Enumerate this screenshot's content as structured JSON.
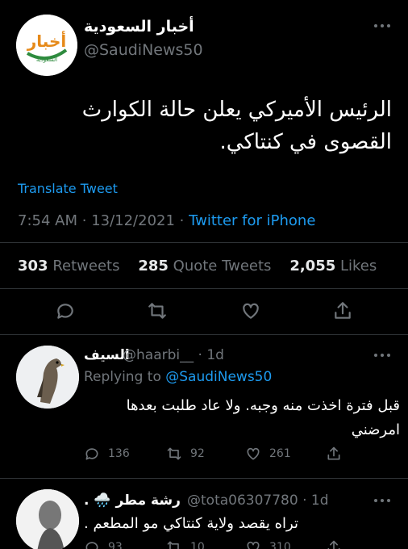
{
  "tweet": {
    "display_name": "أخبار السعودية",
    "handle": "@SaudiNews50",
    "logo_text": "أخبار",
    "logo_subtext": "السعودية",
    "text": "الرئيس الأميركي يعلن حالة الكوارث القصوى في كنتاكي.",
    "translate_label": "Translate Tweet",
    "time": "7:54 AM",
    "date": "13/12/2021",
    "source": "Twitter for iPhone",
    "retweets_count": "303",
    "retweets_label": "Retweets",
    "quotes_count": "285",
    "quotes_label": "Quote Tweets",
    "likes_count": "2,055",
    "likes_label": "Likes"
  },
  "replies": [
    {
      "name": "السيف",
      "handle": "@haarbi__",
      "age": "1d",
      "replying_label": "Replying to",
      "replying_to": "@SaudiNews50",
      "text": "قبل فترة اخذت منه وجبه. ولا عاد طلبت بعدها امرضني",
      "replies": "136",
      "retweets": "92",
      "likes": "261"
    },
    {
      "name": "رشة مطر 🌧️ .",
      "handle": "@tota06307780",
      "age": "1d",
      "text": "تراه يقصد ولاية كنتاكي مو المطعم .",
      "replies": "93",
      "retweets": "10",
      "likes": "310"
    }
  ],
  "colors": {
    "background": "#000000",
    "link_blue": "#1d9bf0",
    "muted": "#71767b",
    "divider": "#2f3336",
    "logo_green": "#2e8b3e",
    "logo_orange": "#e68a1a"
  },
  "icons": [
    "reply-icon",
    "retweet-icon",
    "like-icon",
    "share-icon",
    "more-icon",
    "verified-avatar-logo"
  ]
}
